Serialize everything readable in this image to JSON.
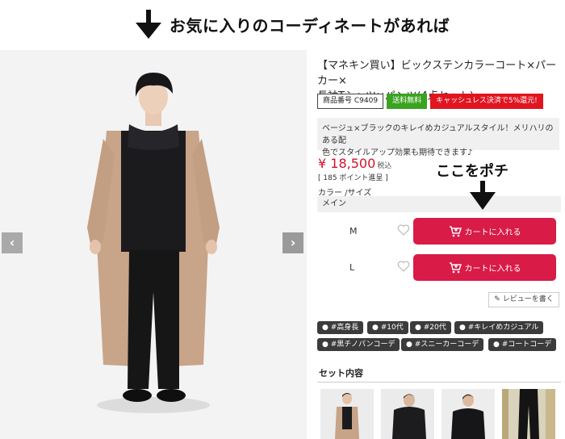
{
  "annotation": {
    "top_text": "お気に入りのコーディネートがあれば",
    "cart_pointer_text": "ここをポチ"
  },
  "gallery": {
    "prev_icon": "‹",
    "next_icon": "›"
  },
  "product": {
    "title_line1": "【マネキン買い】ビックステンカラーコート×パーカー×",
    "title_line2": "長袖Tシャツ×パンツ(4点セット)",
    "badges": {
      "number": "商品番号 C9409",
      "shipping": "送料無料",
      "cashless": "キャッシュレス決済で5%還元!"
    },
    "description_line1": "ベージュ×ブラックのキレイめカジュアルスタイル！メリハリのある配",
    "description_line2": "色でスタイルアップ効果も期待できます♪",
    "price": "¥ 18,500",
    "tax_label": "税込",
    "points": "[ 185 ポイント進呈 ]",
    "color_size_label": "カラー /サイズ",
    "main_color": "メイン",
    "sizes": [
      {
        "label": "M",
        "cart_label": "カートに入れる"
      },
      {
        "label": "L",
        "cart_label": "カートに入れる"
      }
    ],
    "review_button": "✎ レビューを書く",
    "tags": [
      "#高身長",
      "#10代",
      "#20代",
      "#キレイめカジュアル",
      "#黒チノパンコーデ",
      "#スニーカーコーデ",
      "#コートコーデ"
    ],
    "set_title": "セット内容"
  },
  "colors": {
    "accent_red": "#d81b47",
    "price_red": "#d7102b",
    "shipping_green": "#3aa320",
    "tag_dark": "#3b3b3b"
  }
}
